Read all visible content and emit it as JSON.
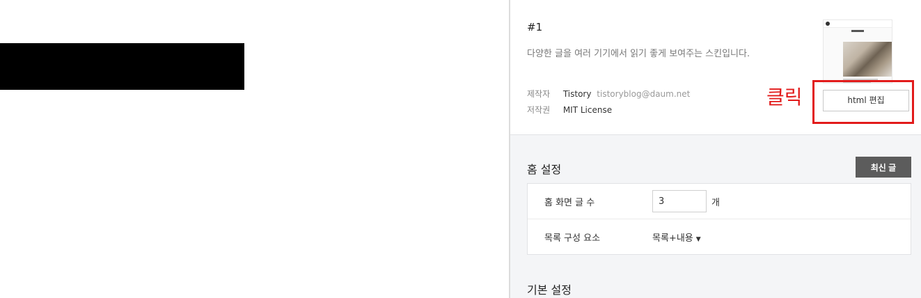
{
  "skin": {
    "number": "#1",
    "description": "다양한 글을 여러 기기에서 읽기 좋게 보여주는 스킨입니다.",
    "creator_label": "제작자",
    "creator_name": "Tistory",
    "creator_email": "tistoryblog@daum.net",
    "license_label": "저작권",
    "license_value": "MIT License",
    "edit_button": "html 편집"
  },
  "annotation": {
    "click_label": "클릭",
    "color": "#e21b1b"
  },
  "home_settings": {
    "title": "홈 설정",
    "latest_button": "최신 글",
    "post_count_label": "홈 화면 글 수",
    "post_count_value": "3",
    "post_count_unit": "개",
    "list_component_label": "목록 구성 요소",
    "list_component_value": "목록+내용"
  },
  "basic_settings": {
    "title": "기본 설정"
  },
  "icons": {
    "dropdown": "caret-down-icon"
  }
}
